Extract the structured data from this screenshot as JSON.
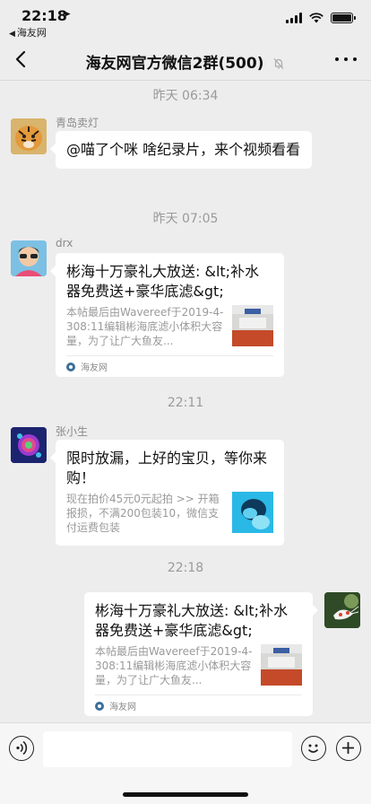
{
  "status_bar": {
    "time": "22:18",
    "back_app": "海友网"
  },
  "nav": {
    "title": "海友网官方微信2群(500)"
  },
  "messages": [
    {
      "timestamp": "昨天 06:34",
      "sender": "青岛卖灯",
      "text": "@喵了个咪 啥纪录片，来个视频看看"
    },
    {
      "timestamp": "昨天 07:05",
      "sender": "drx",
      "card_title": "彬海十万豪礼大放送: &lt;补水器免费送+豪华底滤&gt;",
      "card_desc": "本帖最后由Wavereef于2019-4-308:11编辑彬海底滤小体积大容量，为了让广大鱼友...",
      "card_source": "海友网"
    },
    {
      "timestamp": "22:11",
      "sender": "张小生",
      "card_title": "限时放漏，上好的宝贝，等你来购！",
      "card_desc": "现在拍价45元0元起拍 >> 开箱报损，不满200包装10，微信支付运费包装"
    },
    {
      "timestamp": "22:18",
      "card_title": "彬海十万豪礼大放送: &lt;补水器免费送+豪华底滤&gt;",
      "card_desc": "本帖最后由Wavereef于2019-4-308:11编辑彬海底滤小体积大容量，为了让广大鱼友...",
      "card_source": "海友网"
    }
  ],
  "colors": {
    "background": "#ededed",
    "bubble": "#ffffff",
    "timestamp": "#9a9a9a"
  }
}
